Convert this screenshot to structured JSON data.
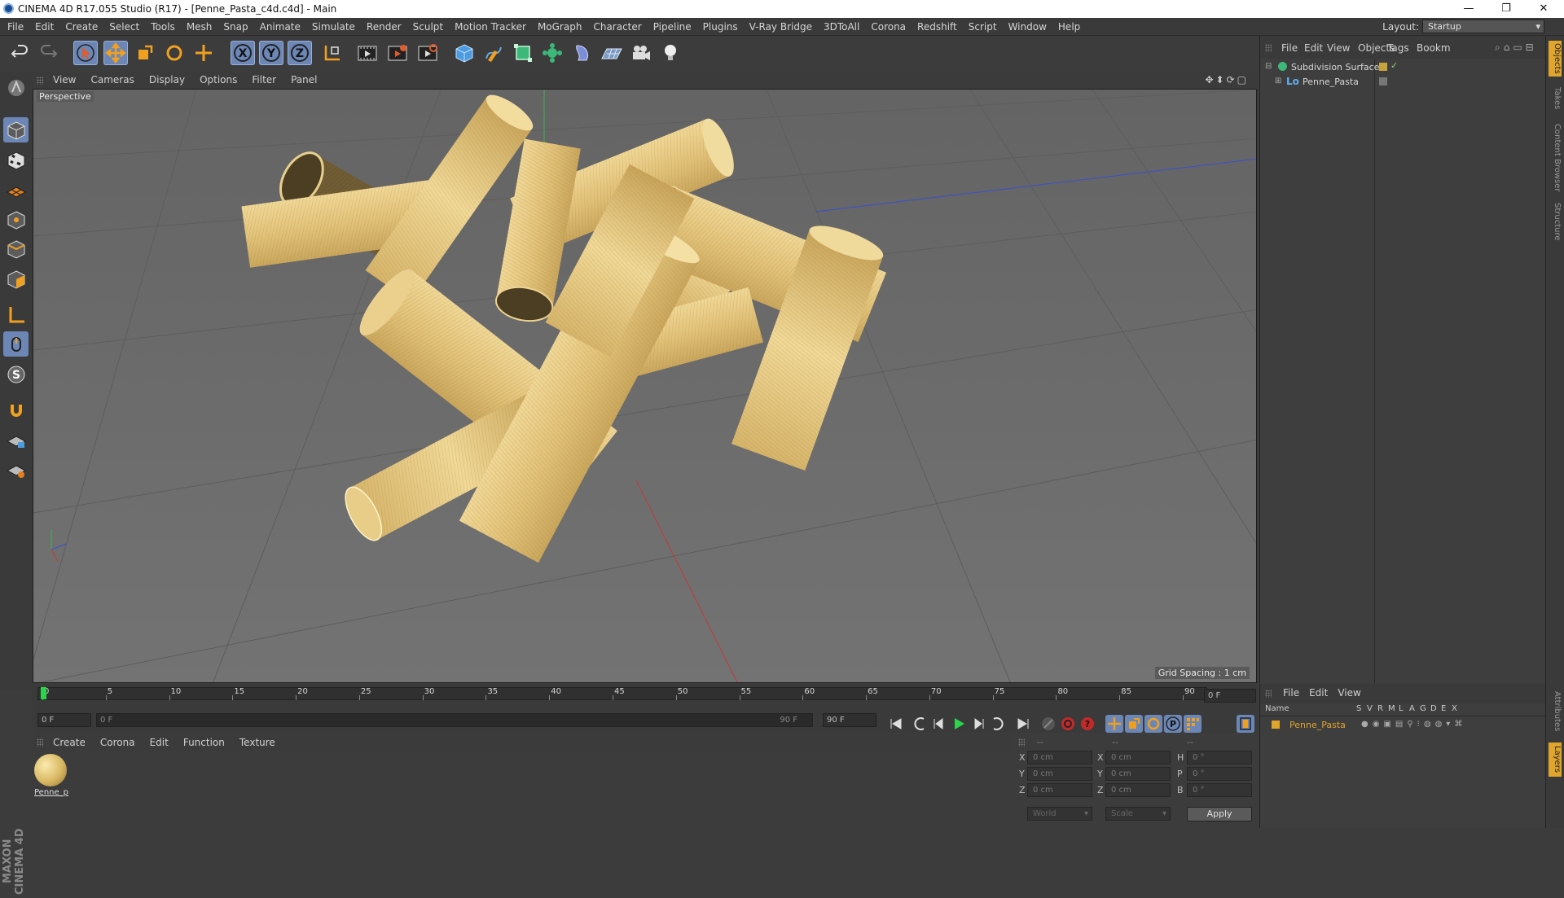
{
  "window": {
    "title": "CINEMA 4D R17.055 Studio (R17) - [Penne_Pasta_c4d.c4d] - Main",
    "controls": [
      "—",
      "❐",
      "✕"
    ]
  },
  "menubar": {
    "items": [
      "File",
      "Edit",
      "Create",
      "Select",
      "Tools",
      "Mesh",
      "Snap",
      "Animate",
      "Simulate",
      "Render",
      "Sculpt",
      "Motion Tracker",
      "MoGraph",
      "Character",
      "Pipeline",
      "Plugins",
      "V-Ray Bridge",
      "3DToAll",
      "Corona",
      "Redshift",
      "Script",
      "Window",
      "Help"
    ],
    "layout_label": "Layout:",
    "layout_value": "Startup"
  },
  "toolbar": {
    "icons": [
      "undo-icon",
      "redo-icon",
      "select-cursor-icon",
      "move-icon",
      "scale-icon",
      "rotate-icon",
      "transform-icon",
      "x-axis-icon",
      "y-axis-icon",
      "z-axis-icon",
      "coordinate-system-icon",
      "render-view-icon",
      "render-picture-viewer-icon",
      "edit-render-settings-icon",
      "cube-primitive-icon",
      "pen-spline-icon",
      "subdivision-generator-icon",
      "array-icon",
      "deformer-icon",
      "floor-icon",
      "camera-icon",
      "light-icon"
    ],
    "axis_labels": [
      "X",
      "Y",
      "Z"
    ]
  },
  "viewport": {
    "menu": [
      "View",
      "Cameras",
      "Display",
      "Options",
      "Filter",
      "Panel"
    ],
    "camera_label": "Perspective",
    "grid_spacing": "Grid Spacing : 1 cm",
    "accent": "#e7c47a"
  },
  "timeline": {
    "ticks": [
      "0",
      "5",
      "10",
      "15",
      "20",
      "25",
      "30",
      "35",
      "40",
      "45",
      "50",
      "55",
      "60",
      "65",
      "70",
      "75",
      "80",
      "85",
      "90"
    ],
    "current_frame": "0 F",
    "start_field": "0 F",
    "range_start": "0 F",
    "range_end": "90 F",
    "end_field": "90 F"
  },
  "materials": {
    "menu": [
      "Create",
      "Corona",
      "Edit",
      "Function",
      "Texture"
    ],
    "items": [
      {
        "name": "Penne_p"
      }
    ]
  },
  "coordinates": {
    "headers": [
      "--",
      "--",
      "--"
    ],
    "rows": [
      {
        "l1": "X",
        "v1": "0 cm",
        "l2": "X",
        "v2": "0 cm",
        "l3": "H",
        "v3": "0 °"
      },
      {
        "l1": "Y",
        "v1": "0 cm",
        "l2": "Y",
        "v2": "0 cm",
        "l3": "P",
        "v3": "0 °"
      },
      {
        "l1": "Z",
        "v1": "0 cm",
        "l2": "Z",
        "v2": "0 cm",
        "l3": "B",
        "v3": "0 °"
      }
    ],
    "mode_world": "World",
    "mode_scale": "Scale",
    "apply_label": "Apply"
  },
  "objects_panel": {
    "menu": [
      "File",
      "Edit",
      "View",
      "Objects",
      "Tags",
      "Bookm"
    ],
    "tree": [
      {
        "name": "Subdivision Surface",
        "indent": 0
      },
      {
        "name": "Penne_Pasta",
        "indent": 1
      }
    ]
  },
  "layers_panel": {
    "menu": [
      "File",
      "Edit",
      "View"
    ],
    "columns": [
      "Name",
      "S",
      "V",
      "R",
      "M",
      "L",
      "A",
      "G",
      "D",
      "E",
      "X"
    ],
    "rows": [
      {
        "name": "Penne_Pasta",
        "color": "#e0a52b"
      }
    ]
  },
  "right_tabs": [
    "Objects",
    "Takes",
    "Content Browser",
    "Structure",
    "Attributes",
    "Layers"
  ],
  "brand": "MAXON CINEMA 4D"
}
